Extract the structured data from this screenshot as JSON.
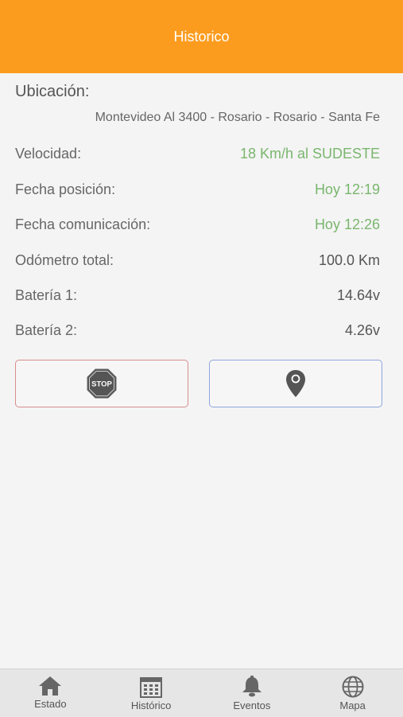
{
  "header": {
    "title": "Historico"
  },
  "location": {
    "title": "Ubicación:",
    "address": "Montevideo Al 3400 - Rosario - Rosario - Santa Fe"
  },
  "rows": [
    {
      "label": "Velocidad:",
      "value": "18 Km/h al SUDESTE",
      "highlight": true
    },
    {
      "label": "Fecha posición:",
      "value": "Hoy 12:19",
      "highlight": true
    },
    {
      "label": "Fecha comunicación:",
      "value": "Hoy 12:26",
      "highlight": true
    },
    {
      "label": "Odómetro total:",
      "value": "100.0 Km",
      "highlight": false
    },
    {
      "label": "Batería 1:",
      "value": "14.64v",
      "highlight": false
    },
    {
      "label": "Batería 2:",
      "value": "4.26v",
      "highlight": false
    }
  ],
  "buttons": {
    "stop": {
      "icon": "stop-sign-icon",
      "text": "STOP",
      "border_color": "#d98c8c"
    },
    "location": {
      "icon": "map-pin-icon",
      "border_color": "#8fa6dc"
    }
  },
  "tabs": [
    {
      "label": "Estado",
      "icon": "home-icon"
    },
    {
      "label": "Histórico",
      "icon": "calendar-icon"
    },
    {
      "label": "Eventos",
      "icon": "bell-icon"
    },
    {
      "label": "Mapa",
      "icon": "globe-icon"
    }
  ],
  "colors": {
    "header": "#fc9c1f",
    "highlight_value": "#7ab66e",
    "background": "#f4f4f4"
  }
}
